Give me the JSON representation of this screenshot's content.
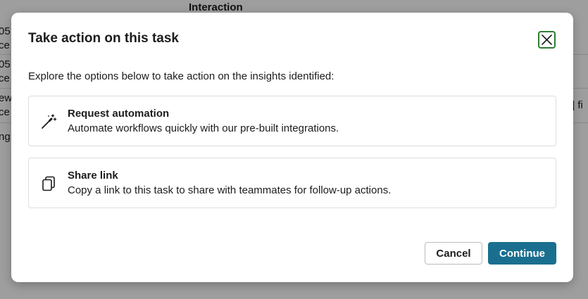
{
  "background": {
    "column_header": "Interaction",
    "fragments": [
      "05",
      "ce",
      "05",
      "ce",
      "ew",
      "ce",
      "ng",
      "] fi"
    ]
  },
  "modal": {
    "title": "Take action on this task",
    "close_icon": "close-icon",
    "intro": "Explore the options below to take action on the insights identified:",
    "options": [
      {
        "icon": "magic-wand-icon",
        "title": "Request automation",
        "description": "Automate workflows quickly with our pre-built integrations."
      },
      {
        "icon": "clipboard-copy-icon",
        "title": "Share link",
        "description": "Copy a link to this task to share with teammates for follow-up actions."
      }
    ],
    "cancel_label": "Cancel",
    "continue_label": "Continue"
  },
  "colors": {
    "primary": "#1a6f8f",
    "close_border": "#2e7d32",
    "overlay": "rgba(0,0,0,0.38)"
  }
}
